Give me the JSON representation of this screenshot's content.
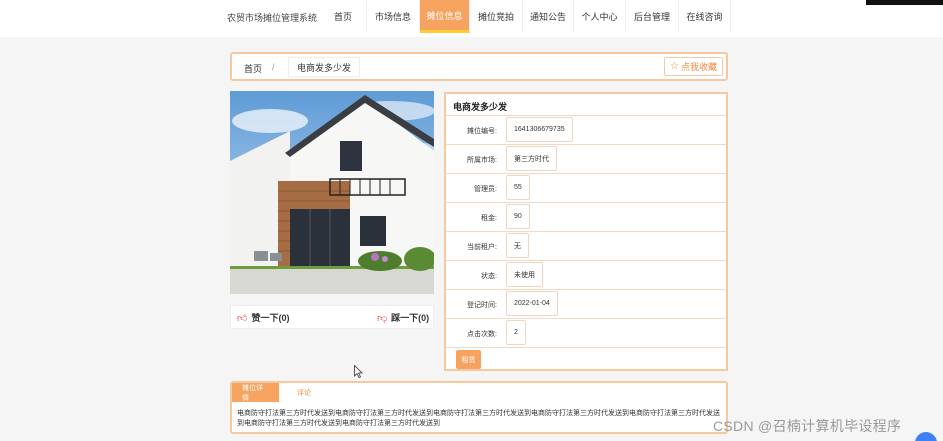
{
  "header": {
    "site_title": "农贸市场摊位管理系统",
    "nav": [
      {
        "label": "首页",
        "active": false
      },
      {
        "label": "市场信息",
        "active": false
      },
      {
        "label": "摊位信息",
        "active": true
      },
      {
        "label": "摊位竞拍",
        "active": false
      },
      {
        "label": "通知公告",
        "active": false
      },
      {
        "label": "个人中心",
        "active": false
      },
      {
        "label": "后台管理",
        "active": false
      },
      {
        "label": "在线咨询",
        "active": false
      }
    ]
  },
  "breadcrumb": {
    "home": "首页",
    "separator": "/",
    "current": "电商发多少发",
    "collect_label": "点我收藏",
    "collect_icon": "star-outline-icon"
  },
  "votes": {
    "like_label": "赞一下(0)",
    "like_icon": "thumbs-up-icon",
    "dislike_label": "踩一下(0)",
    "dislike_icon": "thumbs-down-icon"
  },
  "stall": {
    "title": "电商发多少发",
    "fields": [
      {
        "label": "摊位编号:",
        "value": "1641306679735"
      },
      {
        "label": "所属市场:",
        "value": "第三方时代"
      },
      {
        "label": "管理员:",
        "value": "55"
      },
      {
        "label": "租金:",
        "value": "90"
      },
      {
        "label": "当前租户:",
        "value": "无"
      },
      {
        "label": "状态:",
        "value": "未使用"
      },
      {
        "label": "登记时间:",
        "value": "2022-01-04"
      },
      {
        "label": "点击次数:",
        "value": "2"
      }
    ],
    "rent_button": "租赁"
  },
  "detail": {
    "tabs": [
      {
        "label": "摊位详情",
        "active": true
      },
      {
        "label": "评论",
        "active": false
      }
    ],
    "content": "电商防守打法第三方时代发送到电商防守打法第三方时代发送到电商防守打法第三方时代发送到电商防守打法第三方时代发送到电商防守打法第三方时代发送到电商防守打法第三方时代发送到电商防守打法第三方时代发送到"
  },
  "watermark": "CSDN @召楠计算机毕设程序",
  "colors": {
    "accent": "#f5a35f",
    "accent_border": "#f6c8a0",
    "accent_text": "#f08a3c",
    "active_underline": "#ffcc33",
    "vote_icon": "#e23b3b"
  }
}
